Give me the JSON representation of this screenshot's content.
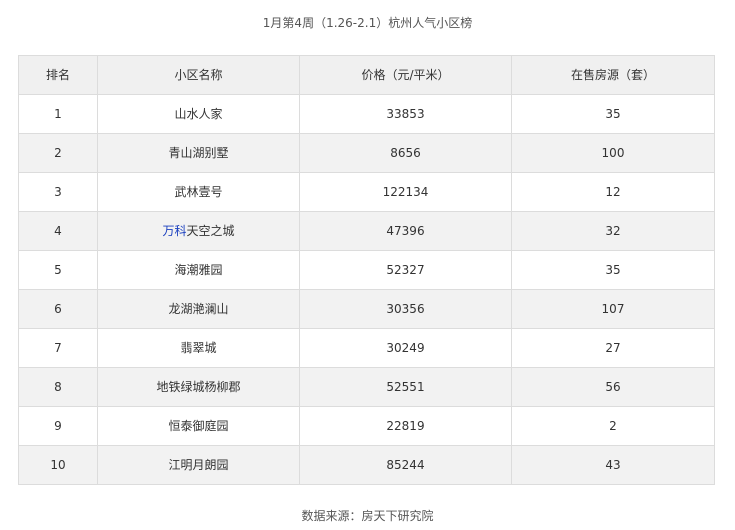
{
  "title": "1月第4周（1.26-2.1）杭州人气小区榜",
  "table": {
    "headers": [
      "排名",
      "小区名称",
      "价格（元/平米）",
      "在售房源（套）"
    ],
    "rows": [
      {
        "rank": "1",
        "name": "山水人家",
        "price": "33853",
        "listings": "35"
      },
      {
        "rank": "2",
        "name": "青山湖别墅",
        "price": "8656",
        "listings": "100"
      },
      {
        "rank": "3",
        "name": "武林壹号",
        "price": "122134",
        "listings": "12"
      },
      {
        "rank": "4",
        "name_link": "万科",
        "name_rest": "天空之城",
        "price": "47396",
        "listings": "32"
      },
      {
        "rank": "5",
        "name": "海潮雅园",
        "price": "52327",
        "listings": "35"
      },
      {
        "rank": "6",
        "name": "龙湖滟澜山",
        "price": "30356",
        "listings": "107"
      },
      {
        "rank": "7",
        "name": "翡翠城",
        "price": "30249",
        "listings": "27"
      },
      {
        "rank": "8",
        "name": "地铁绿城杨柳郡",
        "price": "52551",
        "listings": "56"
      },
      {
        "rank": "9",
        "name": "恒泰御庭园",
        "price": "22819",
        "listings": "2"
      },
      {
        "rank": "10",
        "name": "江明月朗园",
        "price": "85244",
        "listings": "43"
      }
    ]
  },
  "footer": {
    "source": "数据来源：房天下研究院"
  },
  "colors": {
    "link": "#1a3fbf",
    "header_bg": "#f0f0f0",
    "stripe_bg": "#f2f2f2",
    "border": "#dcdcdc"
  }
}
